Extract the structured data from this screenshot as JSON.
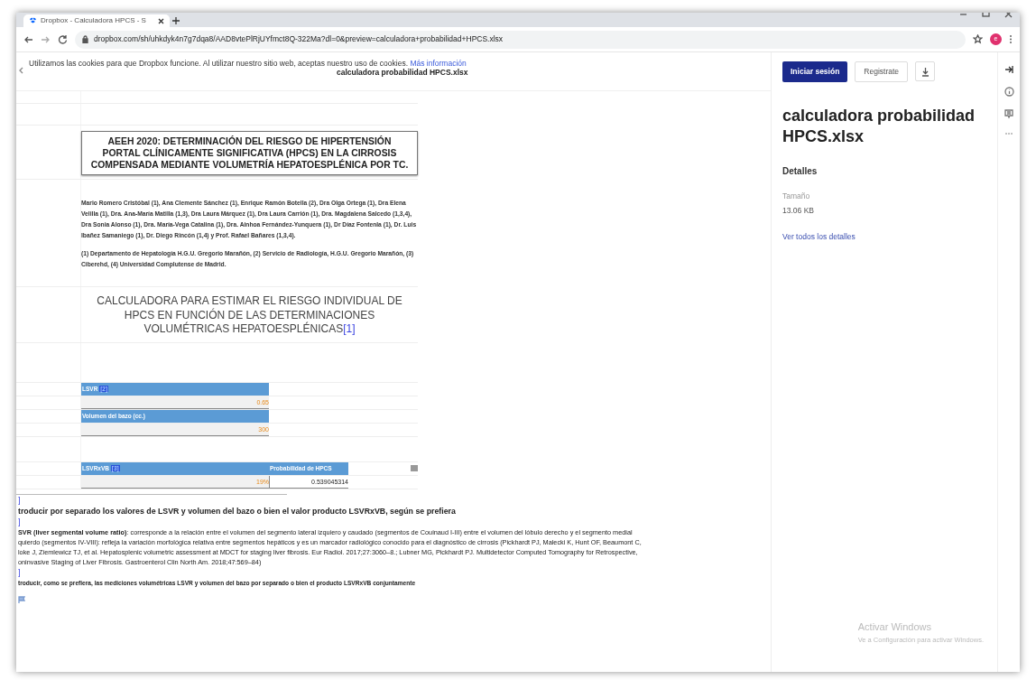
{
  "browser": {
    "tabs": [
      {
        "title": "Dropbox - Calculadora HPCS - S",
        "selected": true
      }
    ],
    "url": "dropbox.com/sh/uhkdyk4n7g7dqa8/AAD8vtePlRjUYfmct8Q-322Ma?dl=0&preview=calculadora+probabilidad+HPCS.xlsx",
    "profile_initial": "e"
  },
  "cookie_banner": {
    "text": "Utilizamos las cookies para que Dropbox funcione. Al utilizar nuestro sitio web, aceptas nuestro uso de cookies.",
    "link": "Más información"
  },
  "preview": {
    "file_title": "calculadora probabilidad HPCS.xlsx",
    "title_box": "AEEH 2020: DETERMINACIÓN DEL RIESGO DE HIPERTENSIÓN PORTAL CLÍNICAMENTE SIGNIFICATIVA (HPCS) EN LA CIRROSIS COMPENSADA MEDIANTE VOLUMETRÍA HEPATOESPLÉNICA POR TC.",
    "authors": "Mario Romero Cristóbal (1), Ana Clemente Sánchez (1), Enrique Ramón Botella (2), Dra Olga Ortega (1), Dra Elena Velilla (1),  Dra. Ana-María Matilla (1,3), Dra Laura Márquez (1), Dra Laura Carrión (1), Dra. Magdalena Salcedo (1,3,4), Dra Sonia Alonso (1), Dra. María-Vega Catalina (1), Dra. Ainhoa Fernández-Yunquera (1), Dr Díaz Fontenla (1), Dr. Luis Ibañez Samaniego (1), Dr. Diego Rincón (1,4) y Prof. Rafael Bañares  (1,3,4).",
    "affiliations": "(1) Departamento de Hepatología H.G.U. Gregorio Marañón, (2) Servicio de Radiología, H.G.U. Gregorio Marañón, (3) Ciberehd, (4) Universidad Complutense de Madrid.",
    "calculator_heading": "CALCULADORA PARA ESTIMAR EL RIESGO INDIVIDUAL DE HPCS EN FUNCIÓN DE LAS DETERMINACIONES VOLUMÉTRICAS HEPATOESPLÉNICAS",
    "heading_ref": "[1]",
    "inputs": [
      {
        "label": "LSVR",
        "ref": "[2]",
        "value": "0.65"
      },
      {
        "label": "Volumen del bazo (cc.)",
        "value": "300"
      }
    ],
    "results": {
      "columns": [
        {
          "label": "LSVRxVB",
          "ref": "[3]"
        },
        {
          "label": "Probabilidad de HPCS"
        }
      ],
      "values": [
        "19%",
        "0.539045314"
      ]
    },
    "footnotes": [
      {
        "mark": "]",
        "kind": "bold",
        "lines": [
          "troducir por separado los valores de LSVR y volumen del bazo o bien el valor producto LSVRxVB, según se prefiera"
        ]
      },
      {
        "mark": "]",
        "kind": "plain",
        "lines": [
          "**SVR (liver segmental volume ratio)**: corresponde a la relación entre el volumen del segmento lateral izquiero y caudado (segmentos de Couinaud I-III) entre el volumen del lóbulo derecho y el segmento medial",
          "quierdo (segmentos IV-VIII): refleja la variación morfológica relativa entre segmentos hepáticos y es un marcador radiológico conocido para el diagnóstico de cirrosis (Pickhardt PJ, Malecki K, Hunt OF, Beaumont C,",
          "loke J, Ziemlewicz TJ, et al. Hepatosplenic volumetric assessment at MDCT for staging liver fibrosis. Eur Radiol. 2017;27:3060–8.; Lubner MG, Pickhardt PJ. Multidetector Computed Tomography for Retrospective,",
          "oninvasive Staging of Liver Fibrosis. Gastroenterol Clin North Am. 2018;47:569–84)"
        ]
      },
      {
        "mark": "]",
        "kind": "small",
        "lines": [
          "troducir, como se prefiera, las mediciones volumétricas LSVR y volumen del bazo por separado o bien el producto LSVRxVB conjuntamente"
        ]
      }
    ]
  },
  "sidebar": {
    "buttons": [
      {
        "label": "Iniciar sesión",
        "kind": "primary"
      },
      {
        "label": "Registrate",
        "kind": "outline"
      }
    ],
    "file_name": "calculadora probabilidad HPCS.xlsx",
    "section": "Detalles",
    "details": [
      {
        "label": "Tamaño",
        "value": "13.06 KB"
      }
    ],
    "link": "Ver todos los detalles"
  },
  "system_notice": {
    "title": "Activar Windows",
    "text": "Ve a Configuración para activar Windows."
  }
}
